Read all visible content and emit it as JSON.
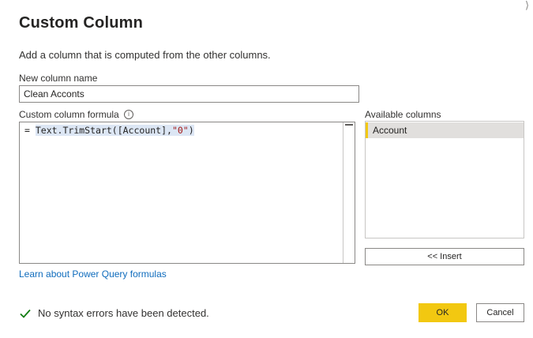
{
  "dialog": {
    "title": "Custom Column",
    "close_glyph": "⟩",
    "description": "Add a column that is computed from the other columns."
  },
  "new_column": {
    "label": "New column name",
    "value": "Clean Acconts"
  },
  "formula": {
    "label": "Custom column formula",
    "info_glyph": "i",
    "prefix": "= ",
    "func": "Text.TrimStart([Account],",
    "string_arg": "\"0\"",
    "suffix": ")"
  },
  "available_columns": {
    "label": "Available columns",
    "items": [
      "Account"
    ],
    "insert_label": "<< Insert"
  },
  "learn_link": "Learn about Power Query formulas",
  "status": {
    "text": "No syntax errors have been detected."
  },
  "buttons": {
    "ok": "OK",
    "cancel": "Cancel"
  },
  "colors": {
    "accent": "#f2c811",
    "link": "#0f6cbd",
    "success": "#107c10"
  }
}
